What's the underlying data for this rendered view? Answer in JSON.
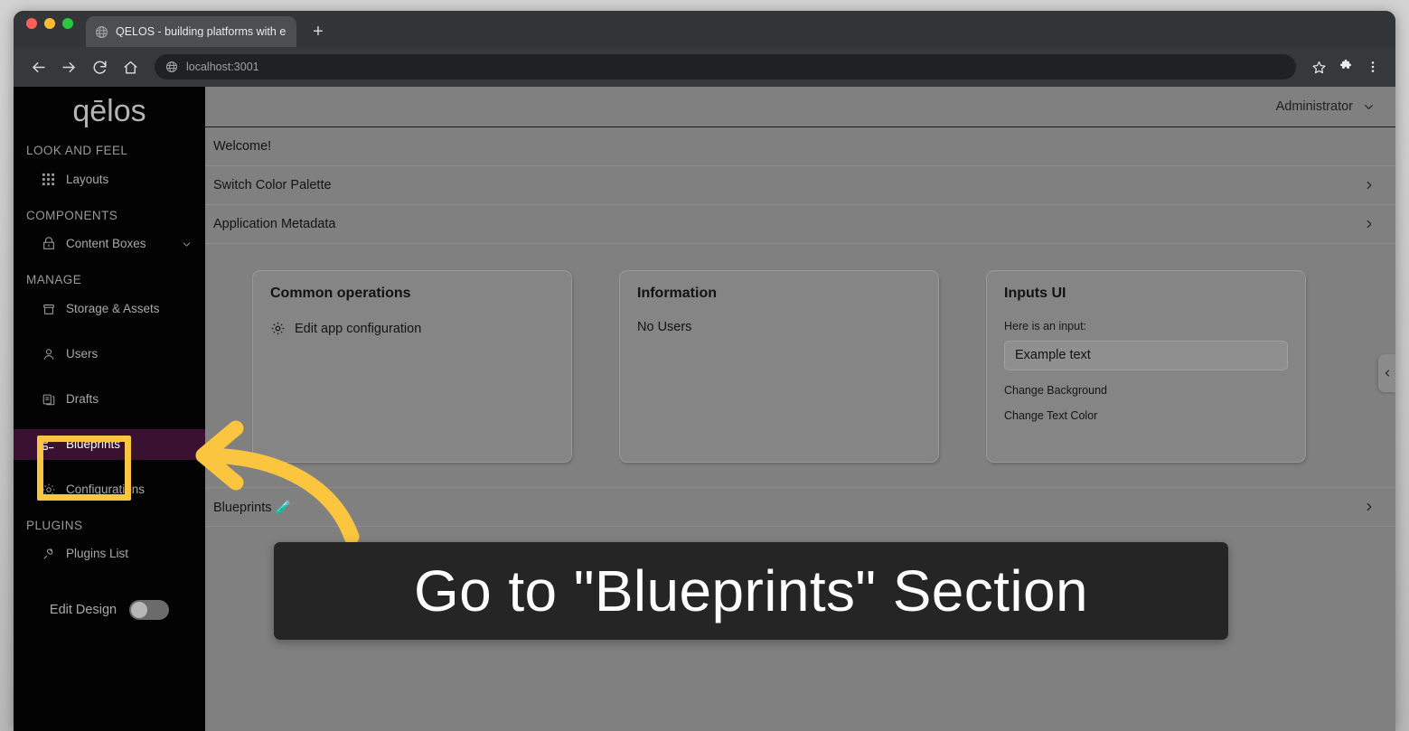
{
  "browser": {
    "tab": {
      "title": "QELOS - building platforms with e",
      "favicon_icon": "globe-icon"
    },
    "new_tab_label": "+",
    "nav": {
      "back_icon": "arrow-left-icon",
      "forward_icon": "arrow-right-icon",
      "reload_icon": "reload-icon",
      "home_icon": "home-icon"
    },
    "omnibox": {
      "url": "localhost:3001",
      "site_icon": "globe-icon"
    },
    "actions": {
      "bookmark_icon": "star-icon",
      "extensions_icon": "puzzle-icon",
      "menu_icon": "three-dots-icon"
    }
  },
  "app": {
    "brand": "qēlos",
    "topbar": {
      "user": "Administrator",
      "chevron_icon": "chevron-down-icon"
    },
    "sidebar": {
      "groups": [
        {
          "title": "LOOK AND FEEL",
          "items": [
            {
              "label": "Layouts",
              "icon": "grid-icon",
              "active": false,
              "expandable": false
            }
          ]
        },
        {
          "title": "COMPONENTS",
          "items": [
            {
              "label": "Content Boxes",
              "icon": "box-icon",
              "active": false,
              "expandable": true
            }
          ]
        },
        {
          "title": "MANAGE",
          "items": [
            {
              "label": "Storage & Assets",
              "icon": "archive-icon",
              "active": false,
              "expandable": false
            },
            {
              "label": "Users",
              "icon": "user-icon",
              "active": false,
              "expandable": false
            },
            {
              "label": "Drafts",
              "icon": "copy-icon",
              "active": false,
              "expandable": false
            },
            {
              "label": "Blueprints",
              "icon": "blueprint-icon",
              "active": true,
              "expandable": false
            },
            {
              "label": "Configurations",
              "icon": "gear-icon",
              "active": false,
              "expandable": false
            }
          ]
        },
        {
          "title": "PLUGINS",
          "items": [
            {
              "label": "Plugins List",
              "icon": "plug-icon",
              "active": false,
              "expandable": false
            }
          ]
        }
      ],
      "edit_design": {
        "label": "Edit Design",
        "enabled": false
      }
    },
    "content": {
      "rows": [
        {
          "label": "Welcome!",
          "chevron": false
        },
        {
          "label": "Switch Color Palette",
          "chevron": true
        },
        {
          "label": "Application Metadata",
          "chevron": true
        }
      ],
      "cards": [
        {
          "title": "Common operations",
          "type": "links",
          "link_label": "Edit app configuration",
          "link_icon": "gear-icon"
        },
        {
          "title": "Information",
          "type": "text",
          "text": "No Users"
        },
        {
          "title": "Inputs UI",
          "type": "inputs",
          "field_label": "Here is an input:",
          "input_value": "Example text",
          "input_placeholder": "Example text",
          "link_background": "Change Background",
          "link_textcolor": "Change Text Color"
        }
      ],
      "blueprints_row": {
        "label": "Blueprints 🧪",
        "chevron": true
      },
      "collapse_handle_icon": "chevron-left-icon"
    }
  },
  "annotation": {
    "caption": "Go to \"Blueprints\" Section",
    "highlight_color": "#fbc53f",
    "arrow_icon": "curved-arrow-left-icon",
    "caption_bg": "#252525"
  }
}
